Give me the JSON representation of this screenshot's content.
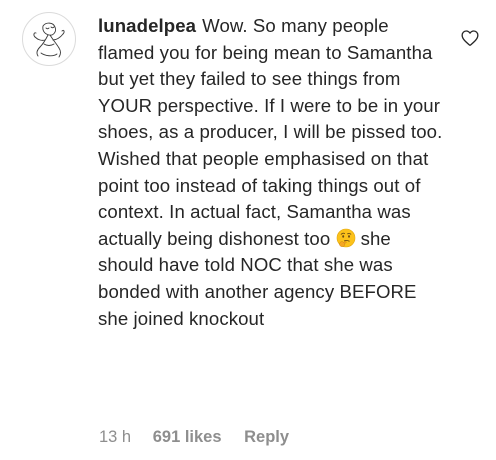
{
  "comment": {
    "username": "lunadelpea",
    "text_part1": "Wow. So many people flamed you for being mean to Samantha but yet they failed to see things from YOUR perspective. If I were to be in your shoes, as a producer, I will be pissed too. Wished that people emphasised on that point too instead of taking things out of context. In actual fact, Samantha was actually being dishonest too",
    "emoji": "thinking-face",
    "text_part2": "she should have told NOC that she was bonded with another agency BEFORE she joined knockout",
    "time": "13 h",
    "likes": "691 likes",
    "reply_label": "Reply"
  },
  "icons": {
    "avatar": "hand-drawn-figure-avatar",
    "like": "heart-outline-icon"
  },
  "colors": {
    "text": "#262626",
    "meta": "#8e8e8e",
    "border": "#dbdbdb"
  }
}
